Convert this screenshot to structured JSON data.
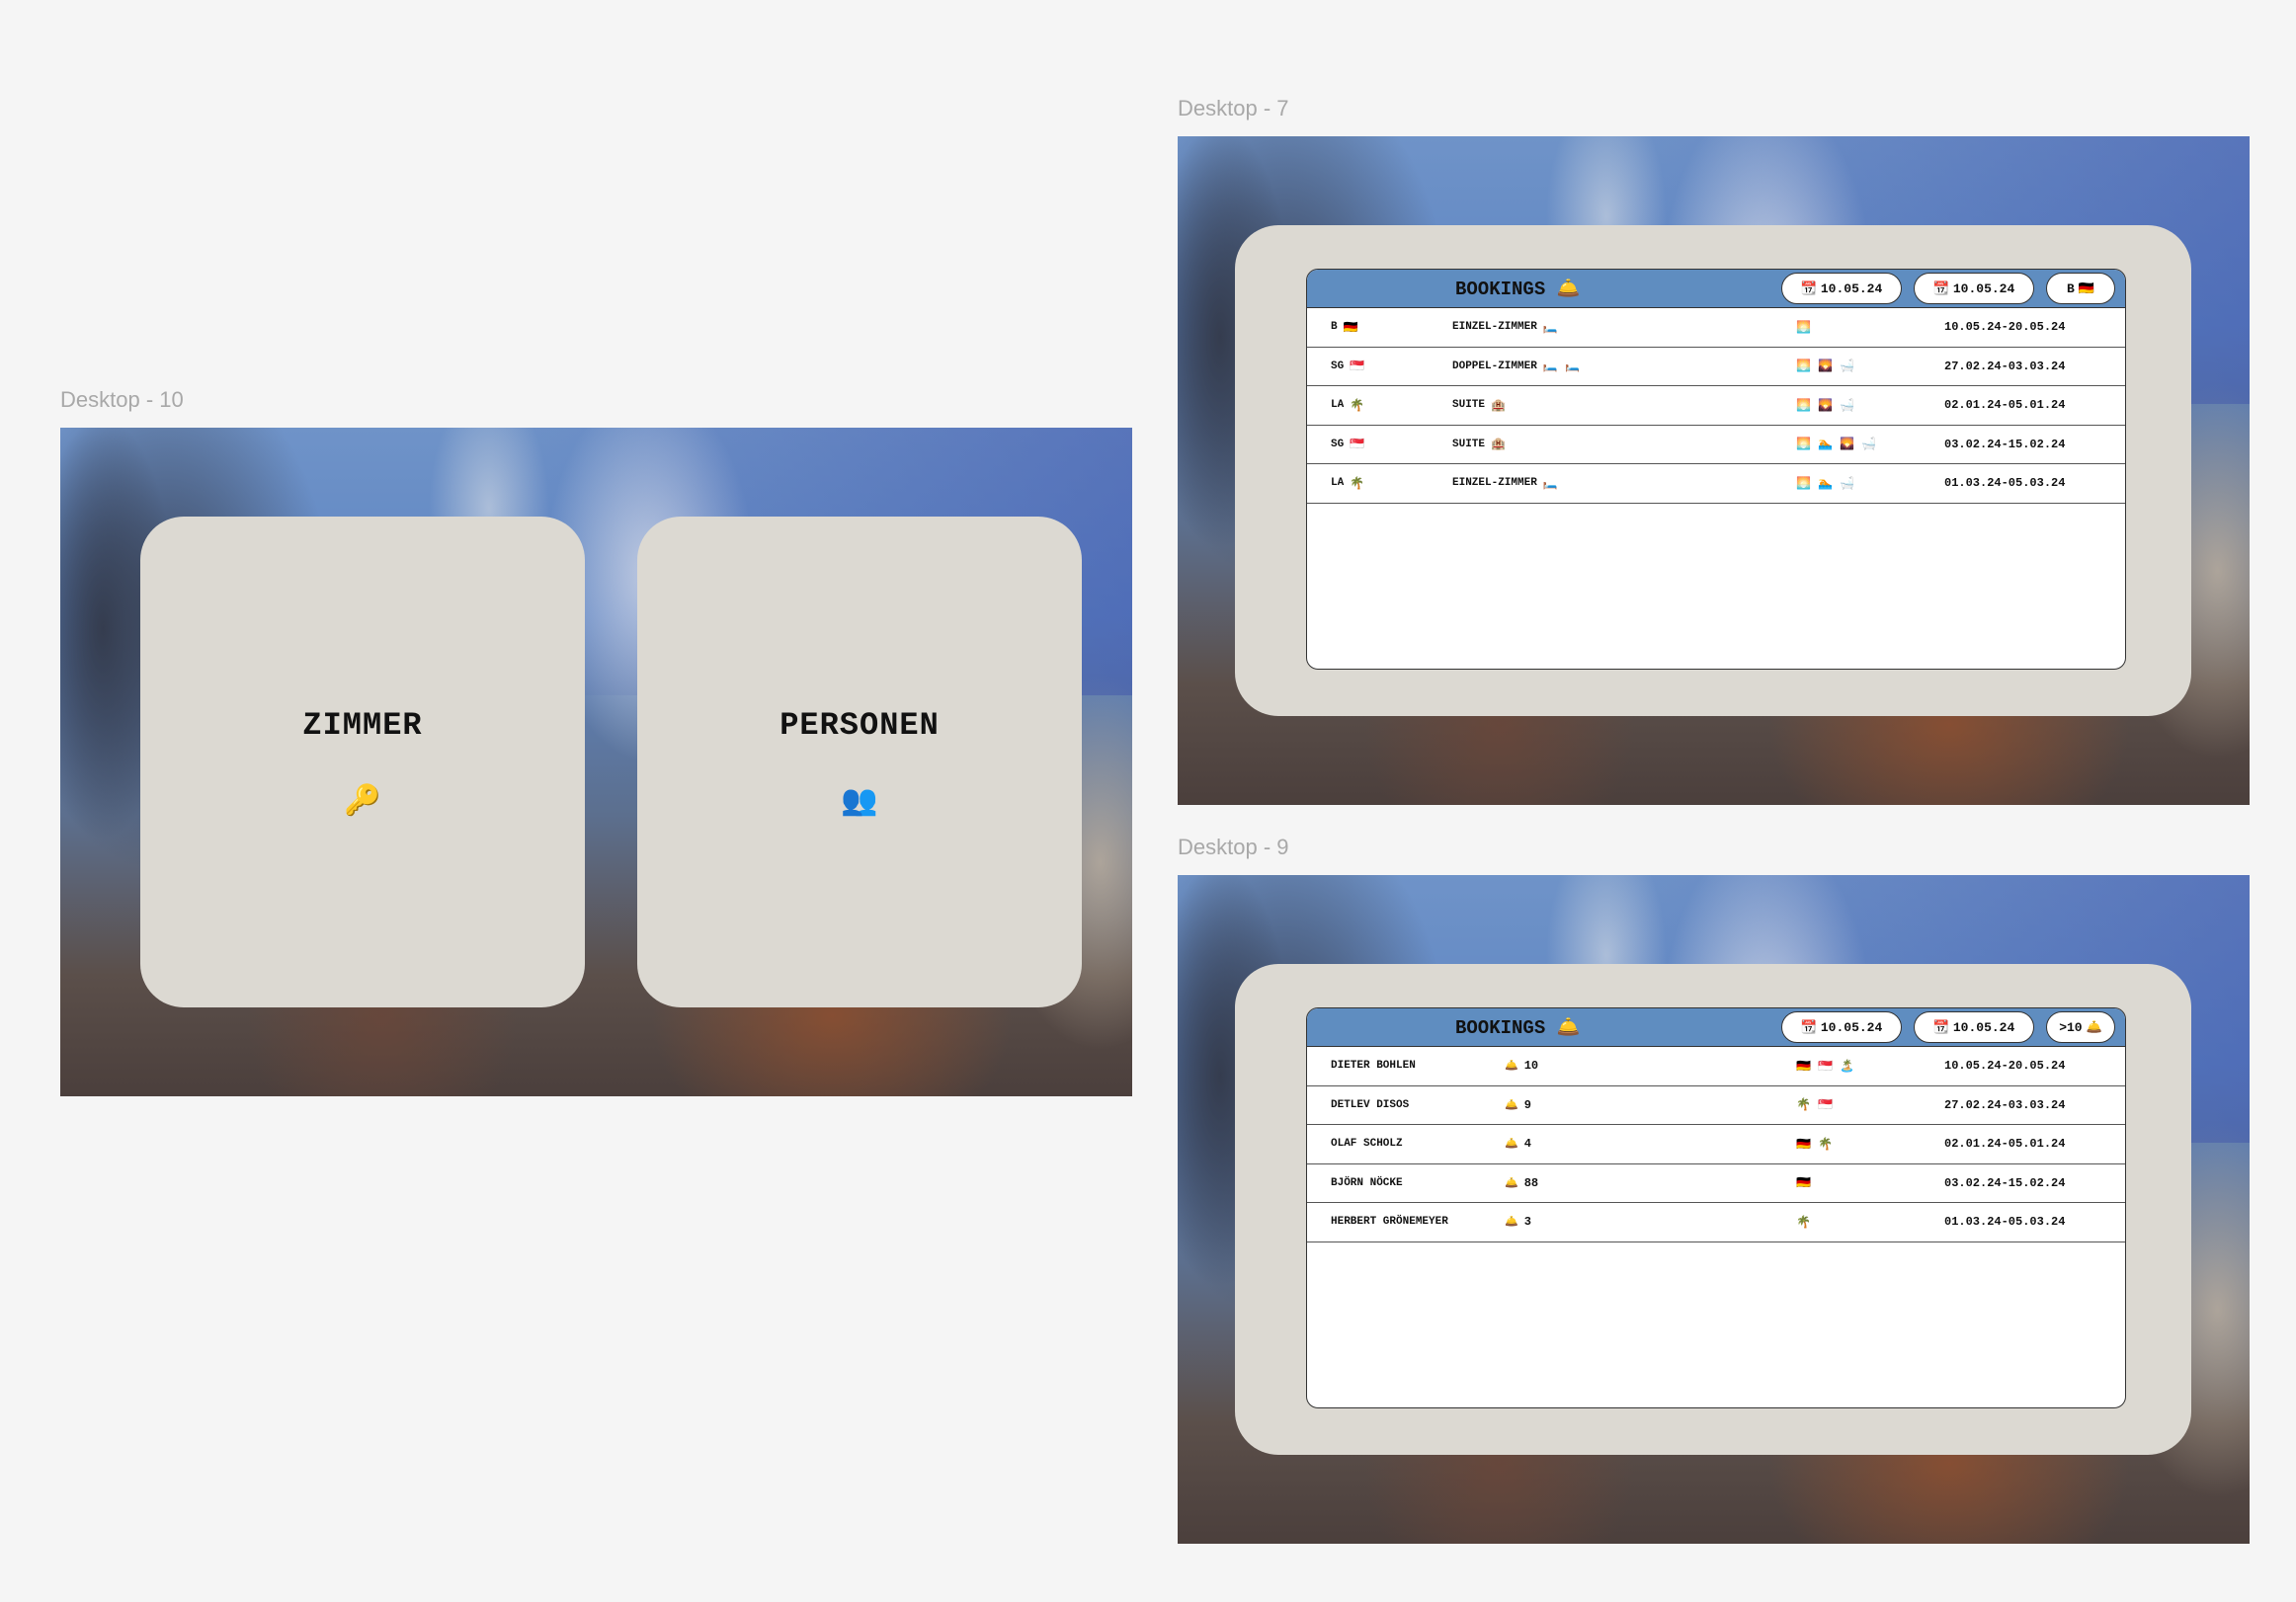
{
  "frames": {
    "desktop10": {
      "label": "Desktop - 10"
    },
    "desktop7": {
      "label": "Desktop - 7"
    },
    "desktop9": {
      "label": "Desktop - 9"
    }
  },
  "tiles": [
    {
      "title": "ZIMMER",
      "icon": "key-icon",
      "glyph": "🔑"
    },
    {
      "title": "PERSONEN",
      "icon": "people-icon",
      "glyph": "👥"
    }
  ],
  "rooms_view": {
    "title": "BOOKINGS",
    "title_icon": "🛎️",
    "filters": [
      {
        "icon": "📆",
        "value": "10.05.24"
      },
      {
        "icon": "📆",
        "value": "10.05.24"
      },
      {
        "value": "B",
        "icon": "🇩🇪"
      }
    ],
    "rows": [
      {
        "guest": "B",
        "guest_icon": "🇩🇪",
        "room": "EINZEL-ZIMMER",
        "room_icon": "🛏️",
        "amenities": "🌅",
        "dates": "10.05.24-20.05.24"
      },
      {
        "guest": "SG",
        "guest_icon": "🇸🇬",
        "room": "DOPPEL-ZIMMER",
        "room_icon": "🛏️ 🛏️",
        "amenities": "🌅 🌄 🛁",
        "dates": "27.02.24-03.03.24"
      },
      {
        "guest": "LA",
        "guest_icon": "🌴",
        "room": "SUITE",
        "room_icon": "🏨",
        "amenities": "🌅 🌄 🛁",
        "dates": "02.01.24-05.01.24"
      },
      {
        "guest": "SG",
        "guest_icon": "🇸🇬",
        "room": "SUITE",
        "room_icon": "🏨",
        "amenities": "🌅 🏊 🌄 🛁",
        "dates": "03.02.24-15.02.24"
      },
      {
        "guest": "LA",
        "guest_icon": "🌴",
        "room": "EINZEL-ZIMMER",
        "room_icon": "🛏️",
        "amenities": "🌅 🏊 🛁",
        "dates": "01.03.24-05.03.24"
      }
    ]
  },
  "persons_view": {
    "title": "BOOKINGS",
    "title_icon": "🛎️",
    "filters": [
      {
        "icon": "📆",
        "value": "10.05.24"
      },
      {
        "icon": "📆",
        "value": "10.05.24"
      },
      {
        "value": ">10",
        "icon": "🛎️"
      }
    ],
    "rows": [
      {
        "name": "DIETER BOHLEN",
        "count_icon": "🛎️",
        "count": "10",
        "places": "🇩🇪 🇸🇬 🏝️",
        "dates": "10.05.24-20.05.24"
      },
      {
        "name": "DETLEV DISOS",
        "count_icon": "🛎️",
        "count": "9",
        "places": "🌴 🇸🇬",
        "dates": "27.02.24-03.03.24"
      },
      {
        "name": "OLAF SCHOLZ",
        "count_icon": "🛎️",
        "count": "4",
        "places": "🇩🇪 🌴",
        "dates": "02.01.24-05.01.24"
      },
      {
        "name": "BJÖRN NÖCKE",
        "count_icon": "🛎️",
        "count": "88",
        "places": "🇩🇪",
        "dates": "03.02.24-15.02.24"
      },
      {
        "name": "HERBERT GRÖNEMEYER",
        "count_icon": "🛎️",
        "count": "3",
        "places": "🌴",
        "dates": "01.03.24-05.03.24"
      }
    ]
  }
}
